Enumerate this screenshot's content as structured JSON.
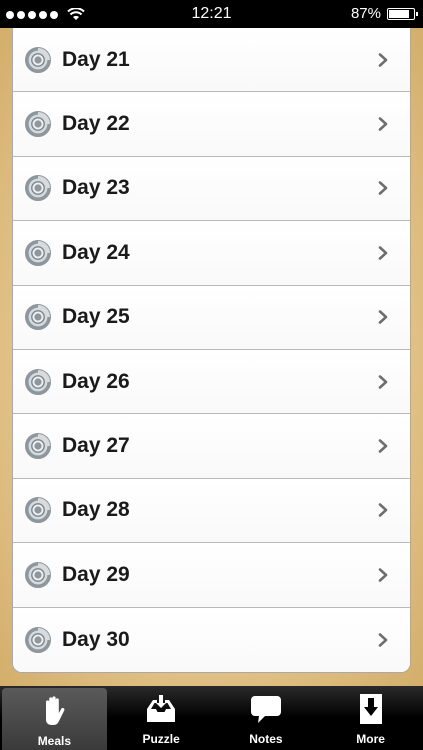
{
  "status": {
    "time": "12:21",
    "battery_text": "87%",
    "battery_level": 0.87,
    "signal_bars": 5
  },
  "list": {
    "icon": "target-icon",
    "chevron_icon": "chevron-right-icon",
    "items": [
      {
        "label": "Day 21"
      },
      {
        "label": "Day 22"
      },
      {
        "label": "Day 23"
      },
      {
        "label": "Day 24"
      },
      {
        "label": "Day 25"
      },
      {
        "label": "Day 26"
      },
      {
        "label": "Day 27"
      },
      {
        "label": "Day 28"
      },
      {
        "label": "Day 29"
      },
      {
        "label": "Day 30"
      }
    ]
  },
  "tabs": [
    {
      "label": "Meals",
      "icon": "hand-icon",
      "active": true
    },
    {
      "label": "Puzzle",
      "icon": "inbox-download-icon",
      "active": false
    },
    {
      "label": "Notes",
      "icon": "speech-bubble-icon",
      "active": false
    },
    {
      "label": "More",
      "icon": "download-arrow-icon",
      "active": false
    }
  ],
  "colors": {
    "icon_gray": "#8e979e",
    "icon_dark": "#5f6a72",
    "chevron": "#6e6e6e"
  }
}
